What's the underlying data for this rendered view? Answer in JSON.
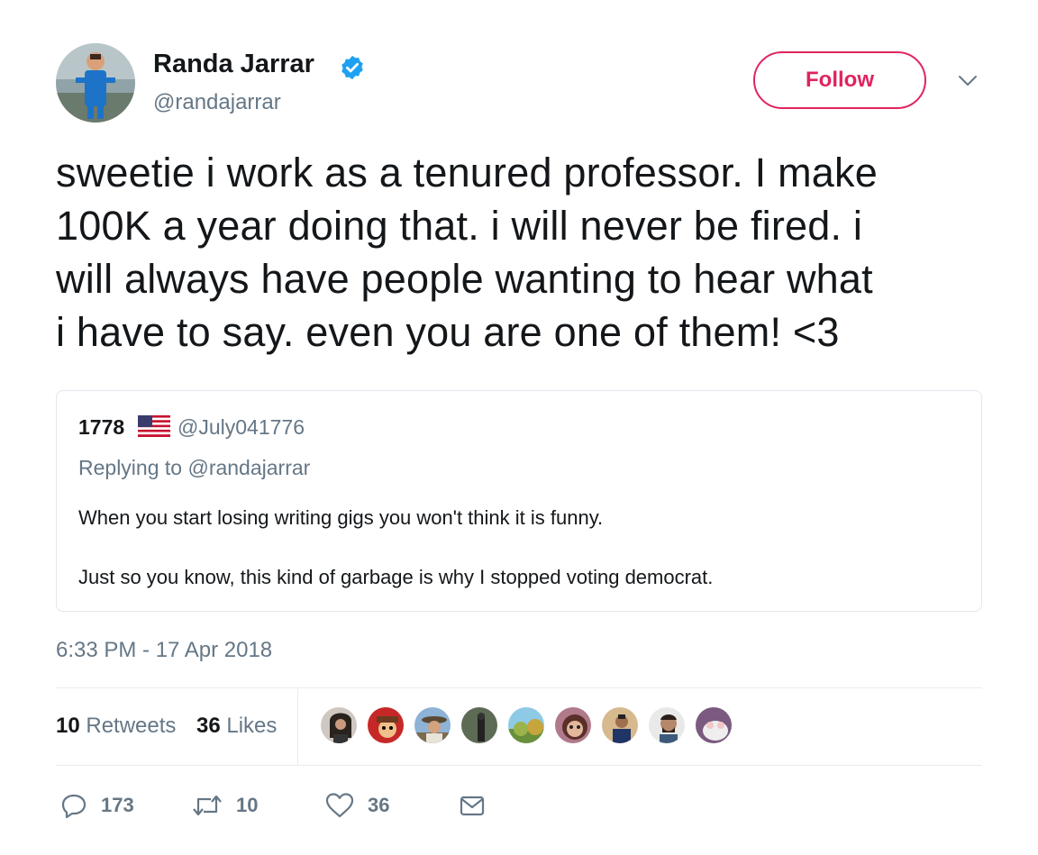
{
  "author": {
    "name": "Randa Jarrar",
    "handle": "@randajarrar",
    "verified_icon": "verified-badge-icon",
    "verified_color": "#1da1f2"
  },
  "follow_label": "Follow",
  "follow_color": "#e0245e",
  "tweet_lines": [
    "sweetie i work as a tenured professor. I make",
    "100K a year doing that. i will never be fired. i",
    "will always have people wanting to hear what",
    "i have to say. even you are one of them! <3"
  ],
  "quoted": {
    "name": "1778",
    "flag_icon": "us-flag-icon",
    "handle": "@July041776",
    "replying_prefix": "Replying to",
    "replying_handle": "@randajarrar",
    "lines": [
      "When you start losing writing gigs you won't think it is funny.",
      "Just so you know, this kind of garbage is why I stopped voting democrat."
    ]
  },
  "timestamp": "6:33 PM - 17 Apr 2018",
  "stats": {
    "retweets_count": "10",
    "retweets_label": "Retweets",
    "likes_count": "36",
    "likes_label": "Likes"
  },
  "actions": {
    "reply_count": "173",
    "retweet_count": "10",
    "like_count": "36"
  },
  "colors": {
    "text": "#14171a",
    "secondary": "#657786",
    "border": "#e1e8ed"
  }
}
